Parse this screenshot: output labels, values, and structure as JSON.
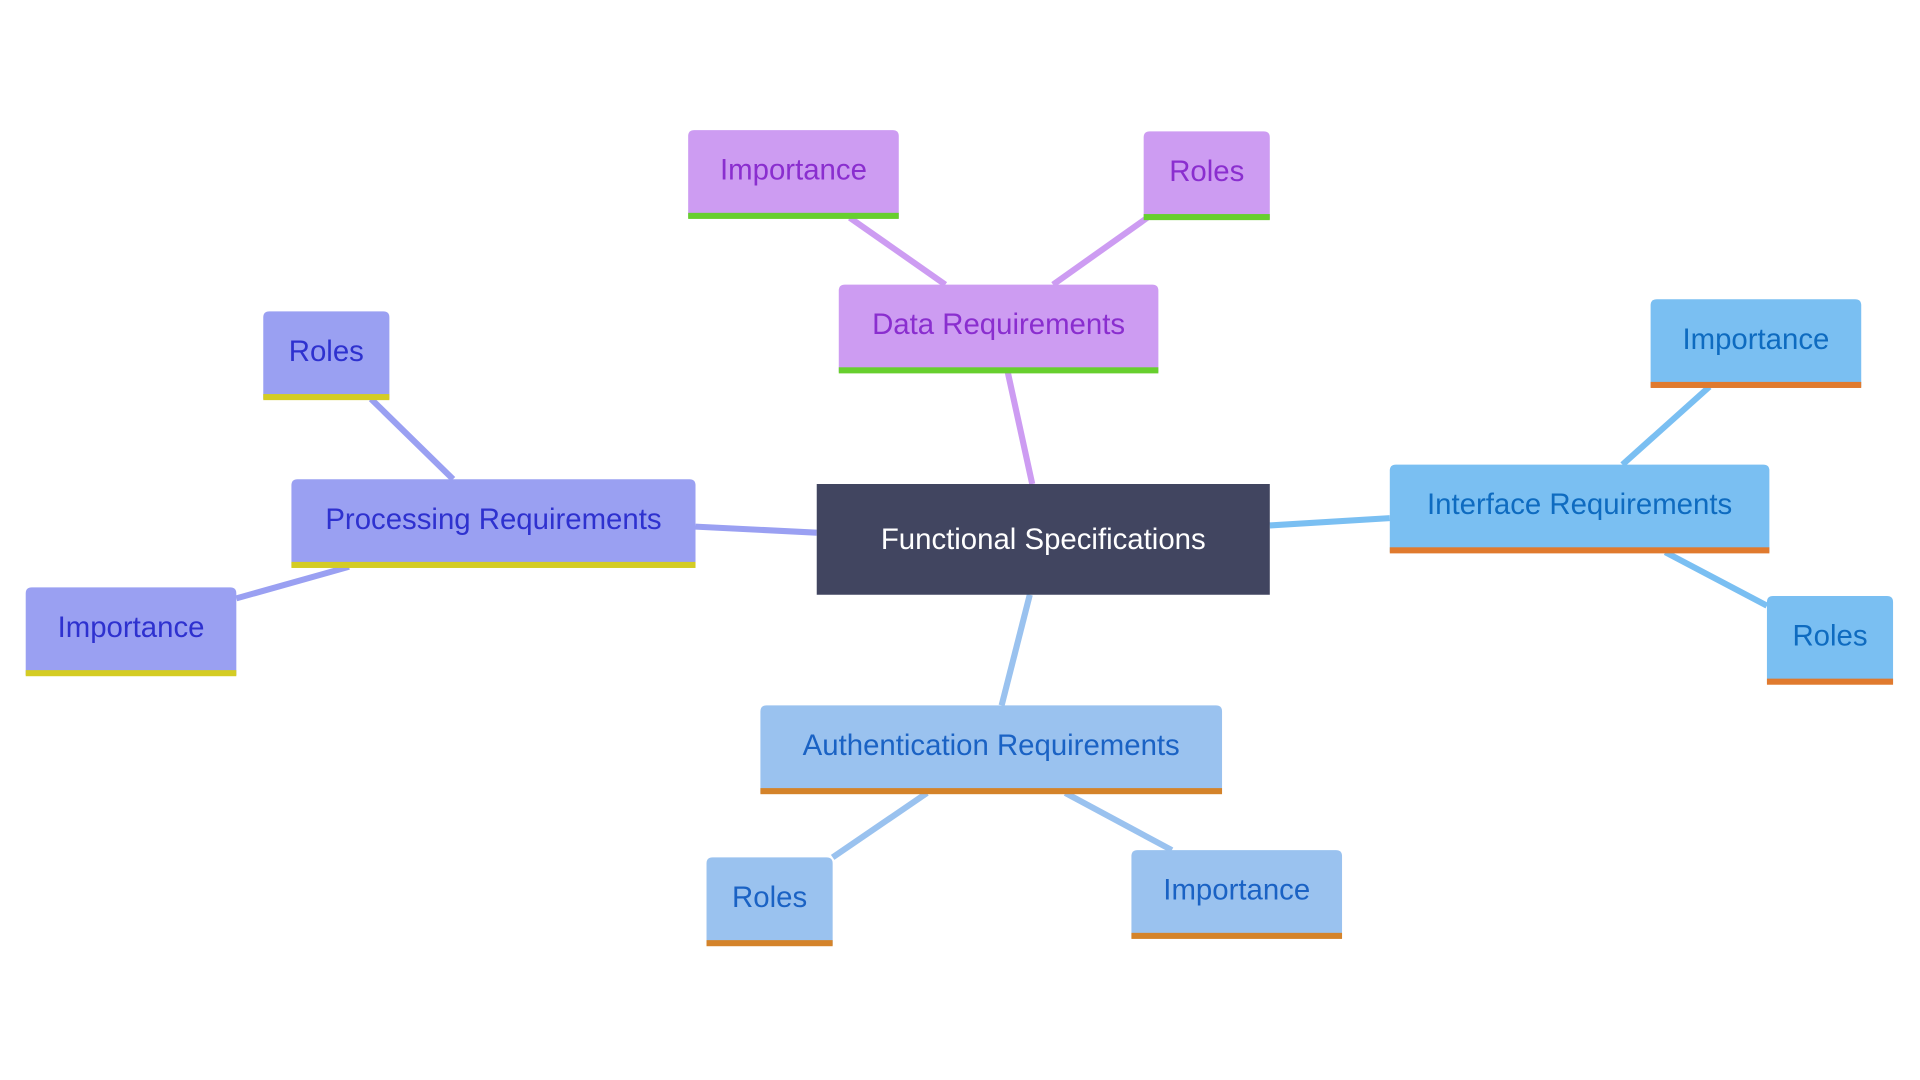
{
  "diagram": {
    "type": "mindmap",
    "root": {
      "label": "Functional Specifications",
      "fill": "#414560",
      "text_color": "#ffffff"
    },
    "branches": [
      {
        "label": "Data Requirements",
        "fill": "#cd9cf2",
        "text_color": "#8a2ecf",
        "underline": "#67cf2e",
        "edge_color": "#cd9cf2",
        "children": [
          "Importance",
          "Roles"
        ]
      },
      {
        "label": "Processing Requirements",
        "fill": "#9aa0f2",
        "text_color": "#2e31cf",
        "underline": "#d4cc24",
        "edge_color": "#9aa0f2",
        "children": [
          "Roles",
          "Importance"
        ]
      },
      {
        "label": "Interface Requirements",
        "fill": "#7abff2",
        "text_color": "#0e6bc0",
        "underline": "#e07a2e",
        "edge_color": "#7abff2",
        "children": [
          "Importance",
          "Roles"
        ]
      },
      {
        "label": "Authentication Requirements",
        "fill": "#9ac2ef",
        "text_color": "#1a62c4",
        "underline": "#d4832a",
        "edge_color": "#9ac2ef",
        "children": [
          "Roles",
          "Importance"
        ]
      }
    ]
  }
}
